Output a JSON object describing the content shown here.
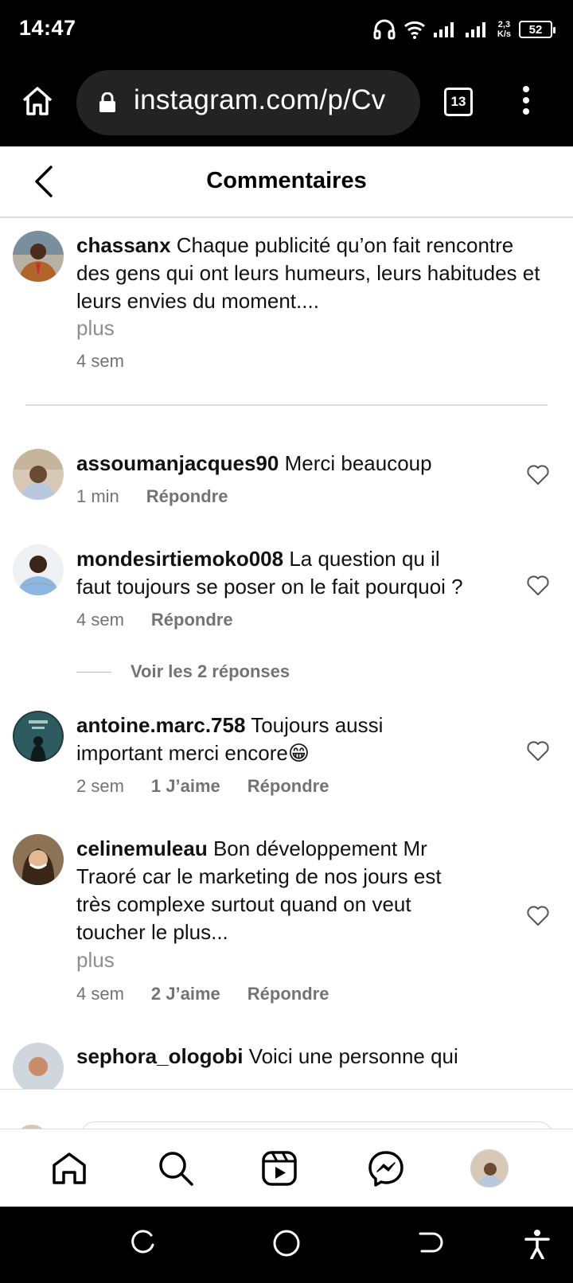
{
  "status_bar": {
    "time": "14:47",
    "speed_value": "2,3",
    "speed_unit": "K/s",
    "battery": "52",
    "icons": [
      "headphones-icon",
      "wifi-icon",
      "signal-icon",
      "signal-icon"
    ]
  },
  "browser": {
    "url": "instagram.com/p/Cv",
    "tab_count": "13",
    "icons": [
      "home-icon",
      "lock-icon",
      "menu-icon"
    ]
  },
  "header": {
    "title": "Commentaires",
    "back_icon": "chevron-left-icon"
  },
  "caption": {
    "username": "chassanx",
    "text_line1": " Chaque publicité qu’on fait rencontre",
    "text_line2": "des gens qui ont leurs humeurs, leurs habitudes et",
    "text_line3": "leurs envies du moment....",
    "more": "plus",
    "time": "4 sem"
  },
  "comments": [
    {
      "username": "assoumanjacques90",
      "lines": [
        " Merci beaucoup"
      ],
      "time": "1 min",
      "likes": "",
      "reply": "Répondre"
    },
    {
      "username": "mondesirtiemoko008",
      "lines": [
        " La question qu il",
        "faut toujours se poser on le fait pourquoi ?"
      ],
      "time": "4 sem",
      "likes": "",
      "reply": "Répondre",
      "view_replies": "Voir les 2 réponses"
    },
    {
      "username": "antoine.marc.758",
      "lines": [
        " Toujours aussi",
        "important merci encore😁"
      ],
      "time": "2 sem",
      "likes": "1 J’aime",
      "reply": "Répondre"
    },
    {
      "username": "celinemuleau",
      "lines": [
        " Bon développement Mr",
        "Traoré car le marketing de nos jours est",
        "très complexe surtout quand on veut",
        "toucher le plus..."
      ],
      "more": "plus",
      "time": "4 sem",
      "likes": "2 J’aime",
      "reply": "Répondre"
    },
    {
      "username": "sephora_ologobi",
      "lines": [
        " Voici une personne qui"
      ]
    }
  ],
  "bottom_nav": {
    "items": [
      "home-icon",
      "search-icon",
      "reels-icon",
      "messenger-icon",
      "profile-avatar"
    ]
  },
  "android_nav": {
    "items": [
      "recents-icon",
      "home-circle-icon",
      "back-icon",
      "accessibility-icon"
    ]
  },
  "colors": {
    "text": "#111111",
    "secondary": "#737373",
    "divider": "#dbdbdb",
    "bar_black": "#000000",
    "url_pill": "#232323"
  }
}
